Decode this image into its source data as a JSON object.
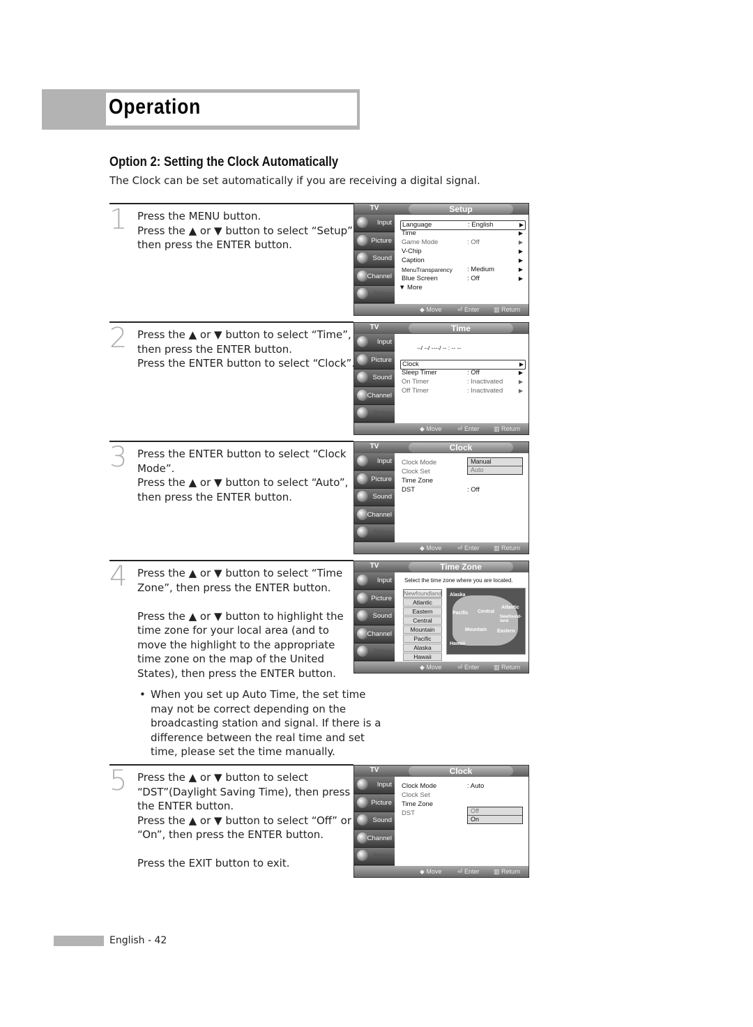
{
  "header": {
    "title": "Operation"
  },
  "section": {
    "title": "Option 2: Setting the Clock Automatically",
    "subtitle": "The Clock can be set automatically if you are receiving a digital signal."
  },
  "steps": [
    {
      "number": "1",
      "text": "Press the MENU button.\nPress the ▲ or ▼ button to select “Setup”, then press the ENTER button."
    },
    {
      "number": "2",
      "text": "Press the ▲ or ▼ button to select “Time”, then press the ENTER button.\nPress the ENTER button to select “Clock”."
    },
    {
      "number": "3",
      "text": "Press the ENTER button to select “Clock Mode”.\nPress the ▲ or ▼ button to select “Auto”, then press the ENTER button."
    },
    {
      "number": "4",
      "text": "Press the ▲ or ▼ button to select “Time Zone”, then press the ENTER button.\n\nPress the ▲ or ▼ button to highlight the time zone for your local area (and to move the highlight to the appropriate time zone on the map of the United States), then press the ENTER button."
    },
    {
      "number": "5",
      "text": "Press the ▲ or ▼ button to select “DST”(Daylight Saving Time), then press the ENTER button.\nPress the ▲ or ▼ button to select “Off” or “On”, then press the ENTER button.\n\nPress the EXIT button to exit."
    }
  ],
  "note": {
    "bullet": "•",
    "text": "When you set up Auto Time, the set time may not be correct depending on the broadcasting station and signal. If there is a difference between the real time and set time, please set the time manually."
  },
  "tv": {
    "label": "TV",
    "sidebar": [
      "Input",
      "Picture",
      "Sound",
      "Channel",
      "Setup"
    ],
    "footer": {
      "move": "Move",
      "enter": "Enter",
      "return": "Return"
    },
    "icons": {
      "move": "updown-icon",
      "enter": "enter-icon",
      "return": "return-icon",
      "arrow": "right-arrow-icon"
    }
  },
  "screens": {
    "setup": {
      "title": "Setup",
      "rows": [
        {
          "label": "Language",
          "value": ": English"
        },
        {
          "label": "Time",
          "value": ""
        },
        {
          "label": "Game Mode",
          "value": ": Off"
        },
        {
          "label": "V-Chip",
          "value": ""
        },
        {
          "label": "Caption",
          "value": ""
        },
        {
          "label": "MenuTransparency",
          "value": ": Medium"
        },
        {
          "label": "Blue Screen",
          "value": ": Off"
        }
      ],
      "more": "▼ More"
    },
    "time": {
      "title": "Time",
      "clock_display": "--/ --/ ----/ -- : -- --",
      "rows": [
        {
          "label": "Clock",
          "value": ""
        },
        {
          "label": "Sleep Timer",
          "value": ": Off"
        },
        {
          "label": "On Timer",
          "value": ": Inactivated"
        },
        {
          "label": "Off Timer",
          "value": ": Inactivated"
        }
      ]
    },
    "clock1": {
      "title": "Clock",
      "rows": [
        {
          "label": "Clock Mode",
          "value": ""
        },
        {
          "label": "Clock Set",
          "value": ""
        },
        {
          "label": "Time Zone",
          "value": ""
        },
        {
          "label": "DST",
          "value": ": Off"
        }
      ],
      "popup": [
        "Manual",
        "Auto"
      ]
    },
    "timezone": {
      "title": "Time Zone",
      "instruction": "Select the time zone where you are located.",
      "zones": [
        "Newfoundland",
        "Atlantic",
        "Eastern",
        "Central",
        "Mountain",
        "Pacific",
        "Alaska",
        "Hawaii"
      ],
      "map_labels": [
        "Alaska",
        "Pacific",
        "Central",
        "Atlantic",
        "Newfound-land",
        "Mountain",
        "Eastern",
        "Hawaii"
      ]
    },
    "clock2": {
      "title": "Clock",
      "rows": [
        {
          "label": "Clock Mode",
          "value": ": Auto"
        },
        {
          "label": "Clock Set",
          "value": ""
        },
        {
          "label": "Time Zone",
          "value": ""
        },
        {
          "label": "DST",
          "value": ""
        }
      ],
      "popup": [
        "Off",
        "On"
      ]
    }
  },
  "footer": {
    "page": "English - 42"
  }
}
